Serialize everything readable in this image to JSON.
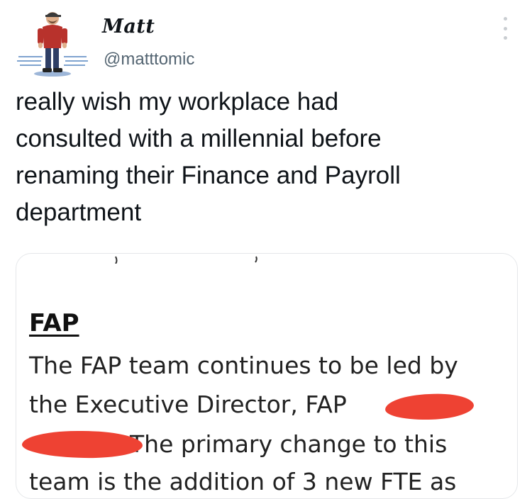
{
  "tweet": {
    "display_name": "Matt",
    "handle": "@matttomic",
    "text": "really wish my workplace had\nconsulted with a millennial before\nrenaming their Finance and Payroll\ndepartment"
  },
  "media": {
    "heading": "FAP",
    "lines": [
      "The FAP team continues to be led by",
      "the Executive Director, FAP",
      "The primary change to this",
      "team is the addition of 3 new FTE as"
    ]
  },
  "colors": {
    "redaction": "#ee4233",
    "secondary_text": "#536471"
  },
  "icons": {
    "avatar": "cartoon-man-avatar",
    "more": "more-vertical-icon"
  }
}
